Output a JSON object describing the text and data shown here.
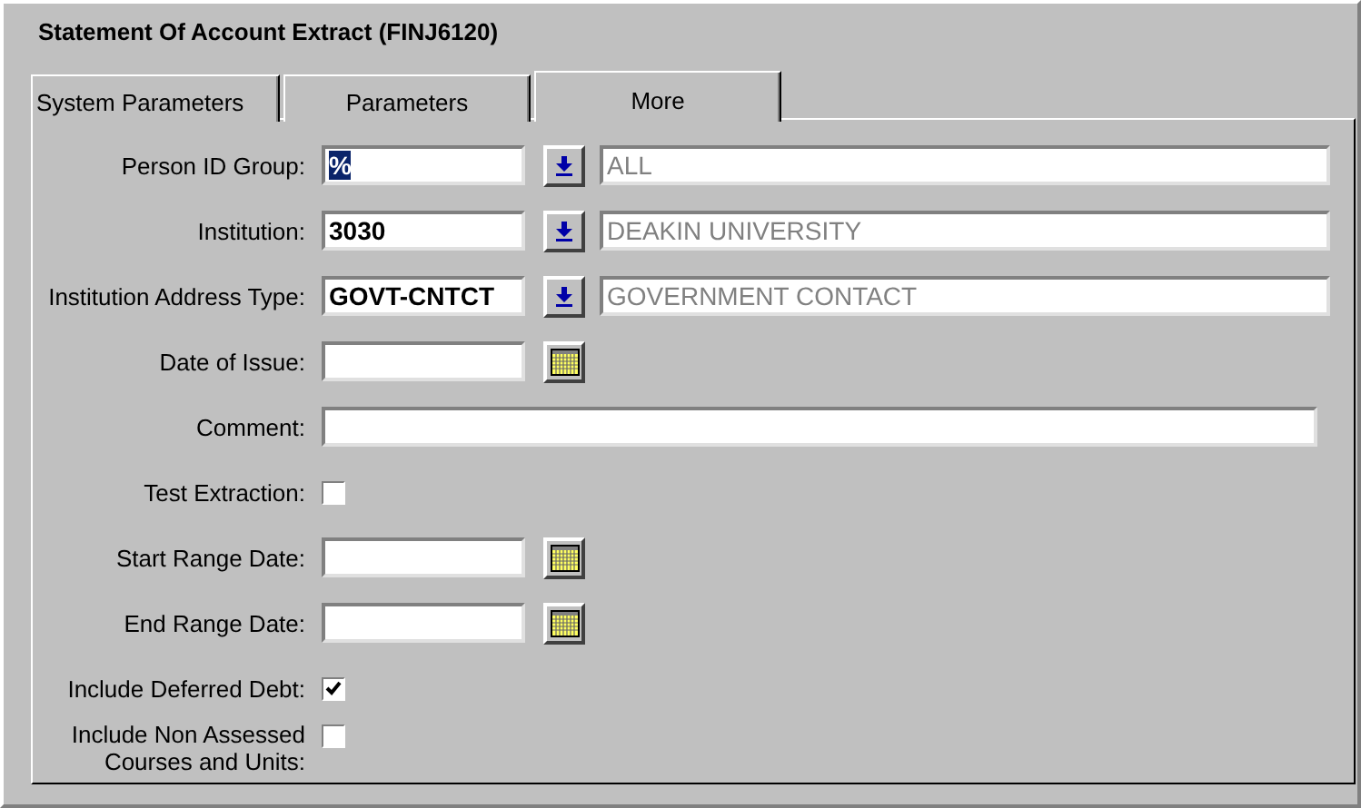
{
  "window": {
    "title": "Statement Of Account Extract (FINJ6120)"
  },
  "tabs": [
    {
      "label": "System Parameters",
      "selected": false
    },
    {
      "label": "Parameters",
      "selected": false
    },
    {
      "label": "More",
      "selected": true
    }
  ],
  "fields": [
    {
      "kind": "lookup",
      "label": "Person ID Group:",
      "value": "%",
      "value_highlighted": true,
      "description": "ALL"
    },
    {
      "kind": "lookup",
      "label": "Institution:",
      "value": "3030",
      "value_highlighted": false,
      "description": "DEAKIN UNIVERSITY"
    },
    {
      "kind": "lookup",
      "label": "Institution Address Type:",
      "value": "GOVT-CNTCT",
      "value_highlighted": false,
      "description": "GOVERNMENT CONTACT"
    },
    {
      "kind": "date",
      "label": "Date of Issue:"
    },
    {
      "kind": "text",
      "label": "Comment:"
    },
    {
      "kind": "checkbox",
      "label": "Test Extraction:",
      "checked": false
    },
    {
      "kind": "date",
      "label": "Start Range Date:"
    },
    {
      "kind": "date",
      "label": "End Range Date:"
    },
    {
      "kind": "checkbox",
      "label": "Include Deferred Debt:",
      "checked": true
    },
    {
      "kind": "checkbox",
      "label": "Include Non Assessed Courses and Units:",
      "checked": false
    }
  ]
}
